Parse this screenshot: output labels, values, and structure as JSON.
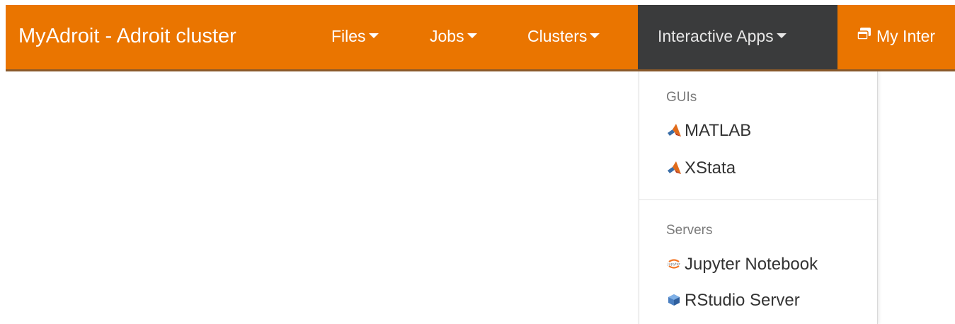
{
  "navbar": {
    "brand": "MyAdroit - Adroit cluster",
    "files_label": "Files",
    "jobs_label": "Jobs",
    "clusters_label": "Clusters",
    "interactive_label": "Interactive Apps",
    "sessions_label": "My Inter",
    "accent_color": "#ea7500",
    "active_color": "#3a3b3c"
  },
  "dropdown": {
    "sections": [
      {
        "header": "GUIs",
        "items": [
          {
            "label": "MATLAB",
            "icon": "matlab-icon"
          },
          {
            "label": "XStata",
            "icon": "matlab-icon"
          }
        ]
      },
      {
        "header": "Servers",
        "items": [
          {
            "label": "Jupyter Notebook",
            "icon": "jupyter-icon"
          },
          {
            "label": "RStudio Server",
            "icon": "rstudio-icon"
          }
        ]
      }
    ]
  }
}
